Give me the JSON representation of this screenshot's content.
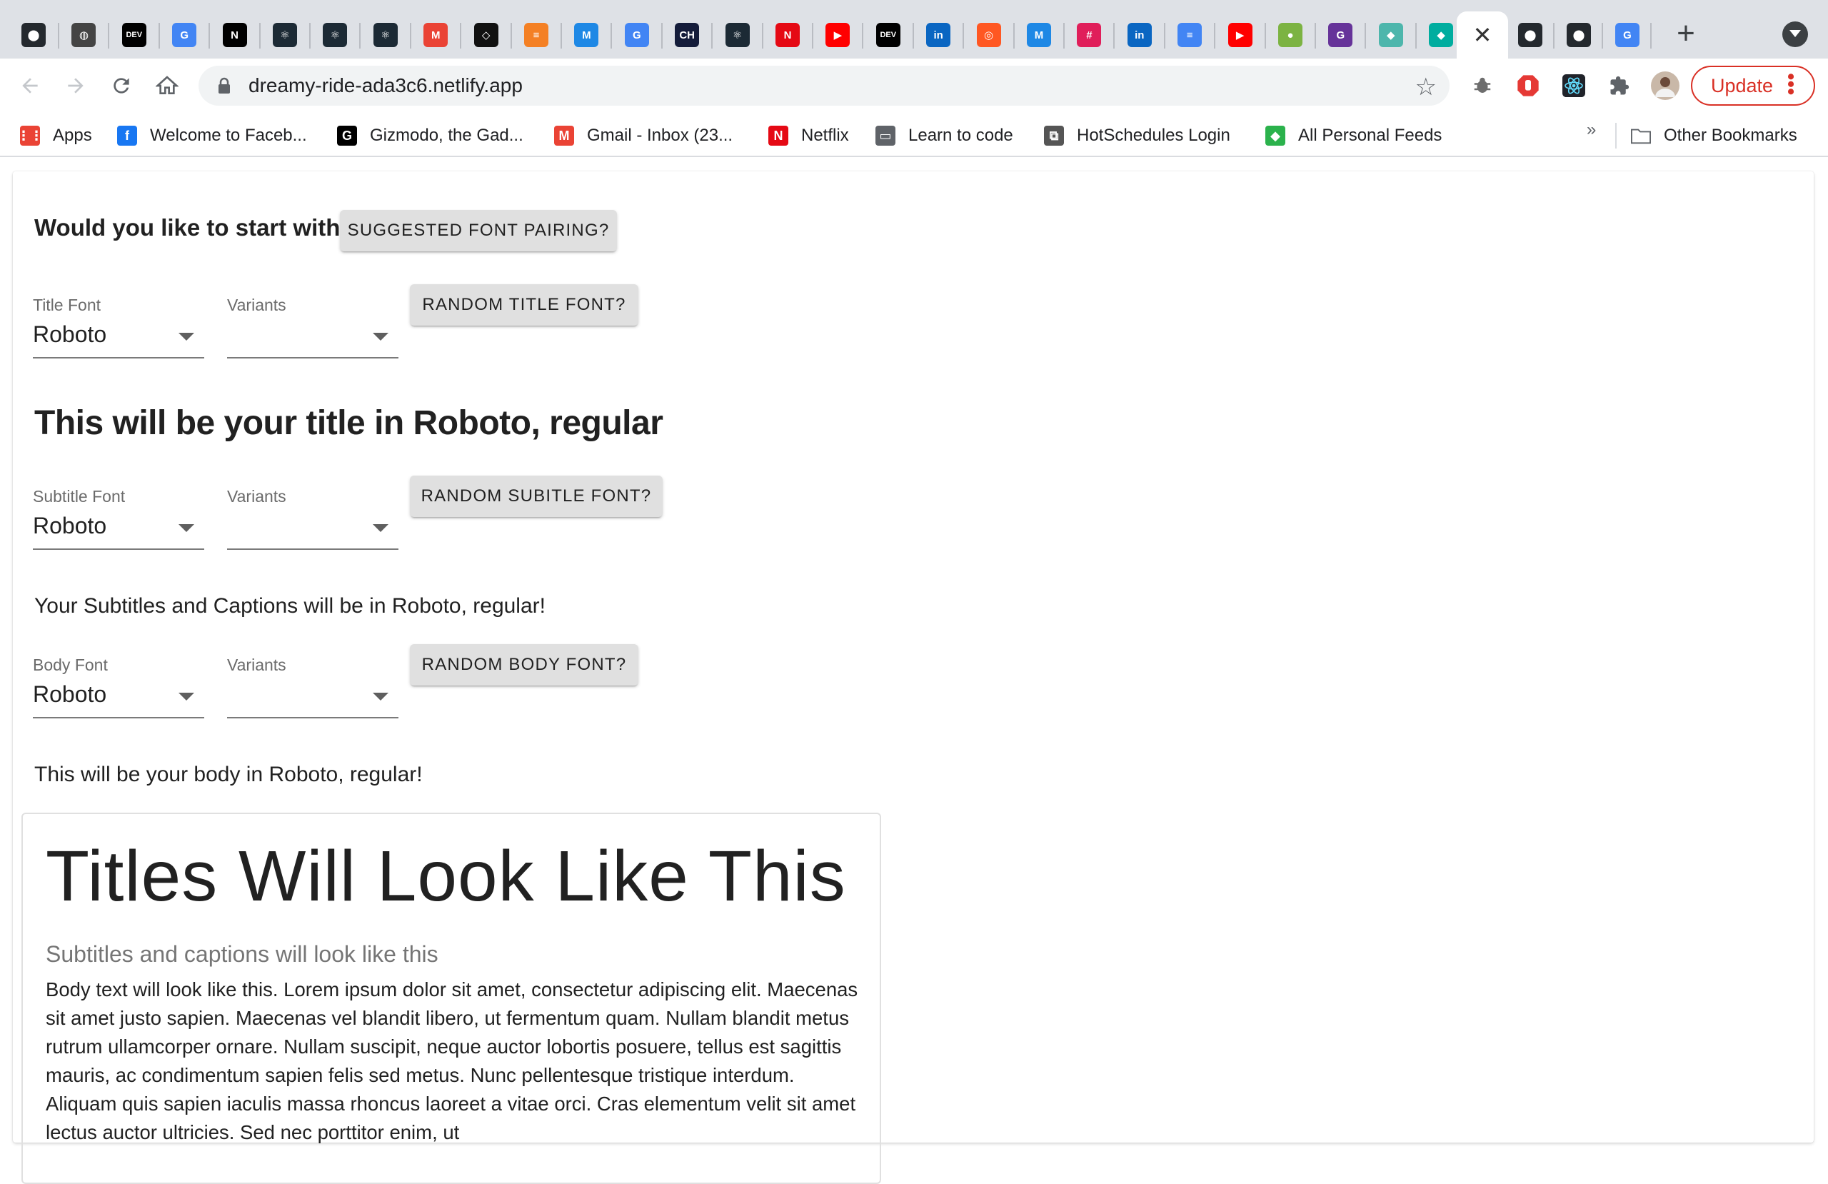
{
  "browser": {
    "tab_favicons": [
      {
        "name": "github",
        "color": "#24292e",
        "glyph": "⬤"
      },
      {
        "name": "globe",
        "color": "#444444",
        "glyph": "◍"
      },
      {
        "name": "dev-to",
        "color": "#000000",
        "glyph": "DEV"
      },
      {
        "name": "google",
        "color": "#4285f4",
        "glyph": "G"
      },
      {
        "name": "notion",
        "color": "#000000",
        "glyph": "N"
      },
      {
        "name": "react",
        "color": "#1c2a35",
        "glyph": "⚛"
      },
      {
        "name": "react",
        "color": "#1c2a35",
        "glyph": "⚛"
      },
      {
        "name": "react",
        "color": "#1c2a35",
        "glyph": "⚛"
      },
      {
        "name": "gmail",
        "color": "#ea4335",
        "glyph": "M"
      },
      {
        "name": "codepen",
        "color": "#111111",
        "glyph": "◇"
      },
      {
        "name": "stack-overflow",
        "color": "#f48024",
        "glyph": "≡"
      },
      {
        "name": "material-ui",
        "color": "#1e88e5",
        "glyph": "M"
      },
      {
        "name": "google",
        "color": "#4285f4",
        "glyph": "G"
      },
      {
        "name": "codecademy",
        "color": "#141c3a",
        "glyph": "CH"
      },
      {
        "name": "react",
        "color": "#1c2a35",
        "glyph": "⚛"
      },
      {
        "name": "netlify-n",
        "color": "#e50914",
        "glyph": "N"
      },
      {
        "name": "youtube",
        "color": "#ff0000",
        "glyph": "▶"
      },
      {
        "name": "dev-to",
        "color": "#000000",
        "glyph": "DEV"
      },
      {
        "name": "linkedin",
        "color": "#0a66c2",
        "glyph": "in"
      },
      {
        "name": "target",
        "color": "#ff5722",
        "glyph": "◎"
      },
      {
        "name": "material-ui",
        "color": "#1e88e5",
        "glyph": "M"
      },
      {
        "name": "slack",
        "color": "#e01e5a",
        "glyph": "#"
      },
      {
        "name": "linkedin",
        "color": "#0a66c2",
        "glyph": "in"
      },
      {
        "name": "google-docs",
        "color": "#4285f4",
        "glyph": "≡"
      },
      {
        "name": "youtube",
        "color": "#ff0000",
        "glyph": "▶"
      },
      {
        "name": "spotify",
        "color": "#7cb342",
        "glyph": "●"
      },
      {
        "name": "gatsby",
        "color": "#663399",
        "glyph": "G"
      },
      {
        "name": "diamond-app",
        "color": "#4db6ac",
        "glyph": "◆"
      },
      {
        "name": "netlify",
        "color": "#00ad9f",
        "glyph": "◆"
      }
    ],
    "tab_favicons_after": [
      {
        "name": "github",
        "color": "#24292e",
        "glyph": "⬤"
      },
      {
        "name": "github",
        "color": "#24292e",
        "glyph": "⬤"
      },
      {
        "name": "google",
        "color": "#4285f4",
        "glyph": "G"
      }
    ],
    "active_tab_close": "✕",
    "new_tab": "+",
    "url": "dreamy-ride-ada3c6.netlify.app",
    "update_label": "Update",
    "bookmarks": [
      {
        "label": "Apps",
        "icon": "apps-icon",
        "color": "#ea4335",
        "glyph": "⋮⋮"
      },
      {
        "label": "Welcome to Faceb...",
        "icon": "facebook-icon",
        "color": "#1877f2",
        "glyph": "f"
      },
      {
        "label": "Gizmodo, the Gad...",
        "icon": "gizmodo-icon",
        "color": "#000000",
        "glyph": "G"
      },
      {
        "label": "Gmail - Inbox (23...",
        "icon": "gmail-icon",
        "color": "#ea4335",
        "glyph": "M"
      },
      {
        "label": "Netflix",
        "icon": "netflix-icon",
        "color": "#e50914",
        "glyph": "N"
      },
      {
        "label": "Learn to code",
        "icon": "folder-icon",
        "color": "#5f6368",
        "glyph": "▭"
      },
      {
        "label": "HotSchedules Login",
        "icon": "hotschedules-icon",
        "color": "#555555",
        "glyph": "⧉"
      },
      {
        "label": "All Personal Feeds",
        "icon": "feedly-icon",
        "color": "#2bb24c",
        "glyph": "◆"
      }
    ],
    "bookmarks_more": "»",
    "other_bookmarks": "Other Bookmarks"
  },
  "page": {
    "question": "Would you like to start with a",
    "suggested_button": "SUGGESTED FONT PAIRING?",
    "title_section": {
      "font_label": "Title Font",
      "font_value": "Roboto",
      "variants_label": "Variants",
      "variants_value": "",
      "random_button": "RANDOM TITLE FONT?",
      "preview": "This will be your title in Roboto, regular"
    },
    "subtitle_section": {
      "font_label": "Subtitle Font",
      "font_value": "Roboto",
      "variants_label": "Variants",
      "variants_value": "",
      "random_button": "RANDOM SUBITLE FONT?",
      "preview": "Your Subtitles and Captions will be in Roboto, regular!"
    },
    "body_section": {
      "font_label": "Body Font",
      "font_value": "Roboto",
      "variants_label": "Variants",
      "variants_value": "",
      "random_button": "RANDOM BODY FONT?",
      "preview": "This will be your body in Roboto, regular!"
    },
    "card": {
      "title": "Titles Will Look Like This",
      "subtitle": "Subtitles and captions will look like this",
      "body": "Body text will look like this. Lorem ipsum dolor sit amet, consectetur adipiscing elit. Maecenas sit amet justo sapien. Maecenas vel blandit libero, ut fermentum quam. Nullam blandit metus rutrum ullamcorper ornare. Nullam suscipit, neque auctor lobortis posuere, tellus est sagittis mauris, ac condimentum sapien felis sed metus. Nunc pellentesque tristique interdum. Aliquam quis sapien iaculis massa rhoncus laoreet a vitae orci. Cras elementum velit sit amet lectus auctor ultricies. Sed nec porttitor enim, ut"
    }
  }
}
